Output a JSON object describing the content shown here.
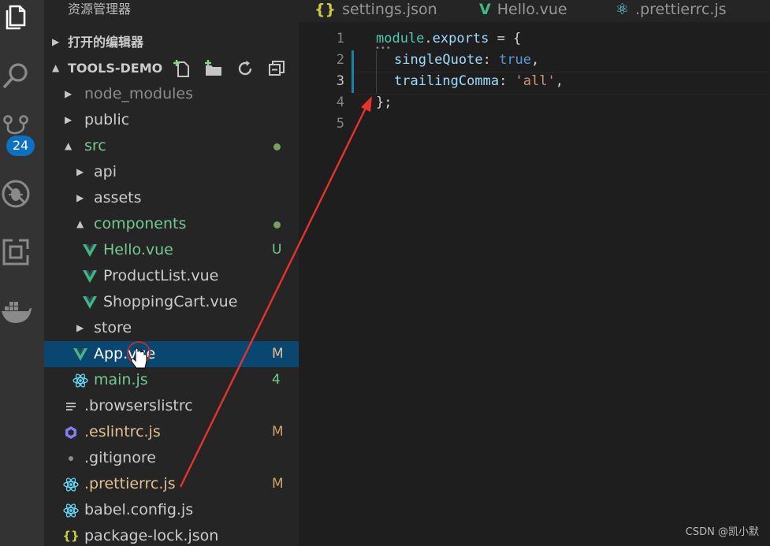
{
  "activity_bar": {
    "items": [
      {
        "icon": "files-icon"
      },
      {
        "icon": "search-icon"
      },
      {
        "icon": "source-control-icon"
      },
      {
        "icon": "debug-icon"
      },
      {
        "icon": "extensions-icon"
      },
      {
        "icon": "docker-icon"
      }
    ],
    "scm_badge": "24"
  },
  "sidebar": {
    "title": "资源管理器",
    "open_editors_label": "打开的编辑器",
    "project_label": "TOOLS-DEMO",
    "tree": [
      {
        "name": "node_modules",
        "kind": "folder",
        "state": "collapsed",
        "color": "dim"
      },
      {
        "name": "public",
        "kind": "folder",
        "state": "collapsed",
        "color": "normal"
      },
      {
        "name": "src",
        "kind": "folder",
        "state": "expanded",
        "color": "green",
        "dot": true
      },
      {
        "name": "api",
        "kind": "folder",
        "state": "collapsed",
        "color": "normal"
      },
      {
        "name": "assets",
        "kind": "folder",
        "state": "collapsed",
        "color": "normal"
      },
      {
        "name": "components",
        "kind": "folder",
        "state": "expanded",
        "color": "green",
        "dot": true
      },
      {
        "name": "Hello.vue",
        "kind": "vue",
        "color": "green",
        "status": "U"
      },
      {
        "name": "ProductList.vue",
        "kind": "vue",
        "color": "normal"
      },
      {
        "name": "ShoppingCart.vue",
        "kind": "vue",
        "color": "normal"
      },
      {
        "name": "store",
        "kind": "folder",
        "state": "collapsed",
        "color": "normal"
      },
      {
        "name": "App.vue",
        "kind": "vue",
        "color": "normal",
        "status": "M",
        "selected": true
      },
      {
        "name": "main.js",
        "kind": "react",
        "color": "green",
        "status": "4"
      },
      {
        "name": ".browserslistrc",
        "kind": "text",
        "color": "normal"
      },
      {
        "name": ".eslintrc.js",
        "kind": "eslint",
        "color": "yellow",
        "status": "M"
      },
      {
        "name": ".gitignore",
        "kind": "git",
        "color": "normal"
      },
      {
        "name": ".prettierrc.js",
        "kind": "react",
        "color": "yellow",
        "status": "M"
      },
      {
        "name": "babel.config.js",
        "kind": "react",
        "color": "normal"
      },
      {
        "name": "package-lock.json",
        "kind": "json",
        "color": "normal"
      }
    ]
  },
  "tabs": [
    {
      "label": "settings.json",
      "icon": "json-icon",
      "glyph": "{}"
    },
    {
      "label": "Hello.vue",
      "icon": "vue-icon",
      "glyph": "V"
    },
    {
      "label": ".prettierrc.js",
      "icon": "react-icon",
      "glyph": "⚛"
    }
  ],
  "editor": {
    "line_numbers": [
      "1",
      "2",
      "3",
      "4",
      "5"
    ],
    "active_line": 3,
    "lines": [
      {
        "parts": [
          [
            "module",
            "obj"
          ],
          [
            ".",
            "def"
          ],
          [
            "exports",
            "prop"
          ],
          [
            " = {",
            "def"
          ]
        ],
        "indent": 0
      },
      {
        "parts": [
          [
            "singleQuote",
            "prop"
          ],
          [
            ": ",
            "def"
          ],
          [
            "true",
            "bool"
          ],
          [
            ",",
            "def"
          ]
        ],
        "indent": 1
      },
      {
        "parts": [
          [
            "trailingComma",
            "prop"
          ],
          [
            ": ",
            "def"
          ],
          [
            "'all'",
            "str"
          ],
          [
            ",",
            "def"
          ]
        ],
        "indent": 1
      },
      {
        "parts": [
          [
            "};",
            "def"
          ]
        ],
        "indent": 0
      },
      {
        "parts": [],
        "indent": 0
      }
    ]
  },
  "watermark": "CSDN @凯小默",
  "colors": {
    "accent_badge": "#0e70c0",
    "selection": "#094771",
    "vue_green": "#41b883",
    "react_blue": "#61dafb",
    "eslint_purple": "#8080f2",
    "git_green": "#73c991",
    "modified_yellow": "#e2c08d",
    "annotation_red": "#e8322c"
  }
}
